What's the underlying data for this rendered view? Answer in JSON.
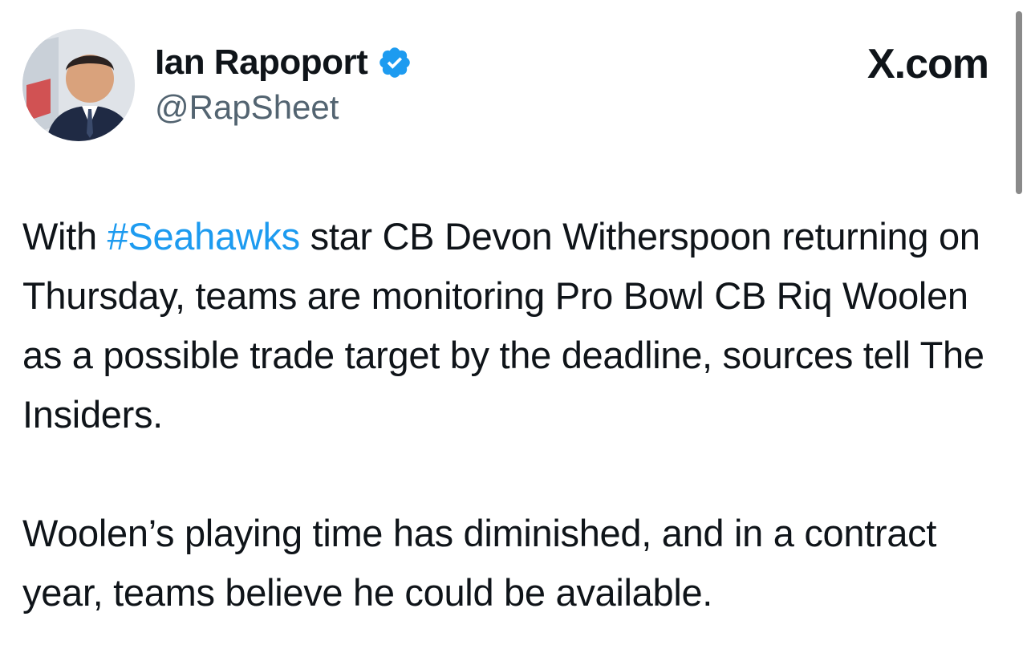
{
  "author": {
    "display_name": "Ian Rapoport",
    "handle": "@RapSheet",
    "verified": true,
    "avatar_icon": "profile-photo"
  },
  "brand": {
    "label": "X.com"
  },
  "tweet": {
    "paragraph1": {
      "prefix": "With ",
      "hashtag": "#Seahawks",
      "rest": " star CB Devon Witherspoon returning on Thursday, teams are monitoring Pro Bowl CB Riq Woolen as a possible trade target by the deadline, sources tell The Insiders."
    },
    "paragraph2": "Woolen’s playing time has diminished, and in a contract year, teams believe he could be available."
  },
  "colors": {
    "hashtag": "#1d9bf0",
    "verified_badge": "#1d9bf0",
    "text": "#0f1419",
    "handle": "#536471"
  }
}
